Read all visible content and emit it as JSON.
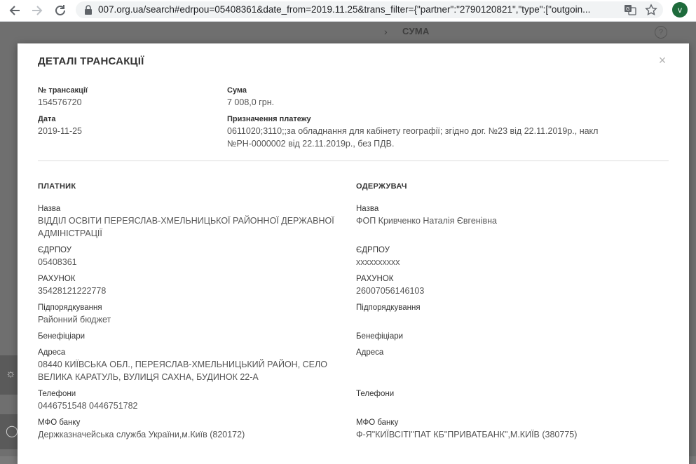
{
  "browser": {
    "url": "007.org.ua/search#edrpou=05408361&date_from=2019.11.25&trans_filter={\"partner\":\"2790120821\",\"type\":[\"outgoin...",
    "avatar_letter": "v"
  },
  "background": {
    "column_header": "СУМА",
    "help_glyph": "?"
  },
  "modal": {
    "title": "ДЕТАЛІ ТРАНСАКЦІЇ",
    "close_glyph": "×",
    "transaction_no_label": "№ трансакції",
    "transaction_no": "154576720",
    "sum_label": "Сума",
    "sum": "7 008,0 грн.",
    "date_label": "Дата",
    "date": "2019-11-25",
    "purpose_label": "Призначення платежу",
    "purpose_line1": "0611020;3110;;за обладнання для кабінету географії; згідно дог. №23 від 22.11.2019р., накл",
    "purpose_line2": "№РН-0000002 від 22.11.2019р., без ПДВ."
  },
  "payer": {
    "section": "ПЛАТНИК",
    "name_label": "Назва",
    "name_line1": "ВІДДІЛ ОСВІТИ ПЕРЕЯСЛАВ-ХМЕЛЬНИЦЬКОЇ РАЙОННОЇ ДЕРЖАВНОЇ",
    "name_line2": "АДМІНІСТРАЦІЇ",
    "edrpou_label": "ЄДРПОУ",
    "edrpou": "05408361",
    "account_label": "РАХУНОК",
    "account": "35428121222778",
    "subordination_label": "Підпорядкування",
    "subordination": "Районний бюджет",
    "beneficiaries_label": "Бенефіціари",
    "address_label": "Адреса",
    "address_line1": "08440 КИЇВСЬКА ОБЛ., ПЕРЕЯСЛАВ-ХМЕЛЬНИЦЬКИЙ РАЙОН, СЕЛО",
    "address_line2": "ВЕЛИКА КАРАТУЛЬ, ВУЛИЦЯ САХНА, БУДИНОК 22-А",
    "phones_label": "Телефони",
    "phones": "0446751548 0446751782",
    "mfo_label": "МФО банку",
    "mfo": "Держказначейська служба України,м.Київ (820172)"
  },
  "recipient": {
    "section": "ОДЕРЖУВАЧ",
    "name_label": "Назва",
    "name": "ФОП Кривченко Наталія Євгенівна",
    "edrpou_label": "ЄДРПОУ",
    "edrpou": "xxxxxxxxxx",
    "account_label": "РАХУНОК",
    "account": "26007056146103",
    "subordination_label": "Підпорядкування",
    "beneficiaries_label": "Бенефіціари",
    "address_label": "Адреса",
    "phones_label": "Телефони",
    "mfo_label": "МФО банку",
    "mfo": "Ф-Я\"КИЇВСІТІ\"ПАТ КБ\"ПРИВАТБАНК\",М.КИЇВ (380775)"
  }
}
